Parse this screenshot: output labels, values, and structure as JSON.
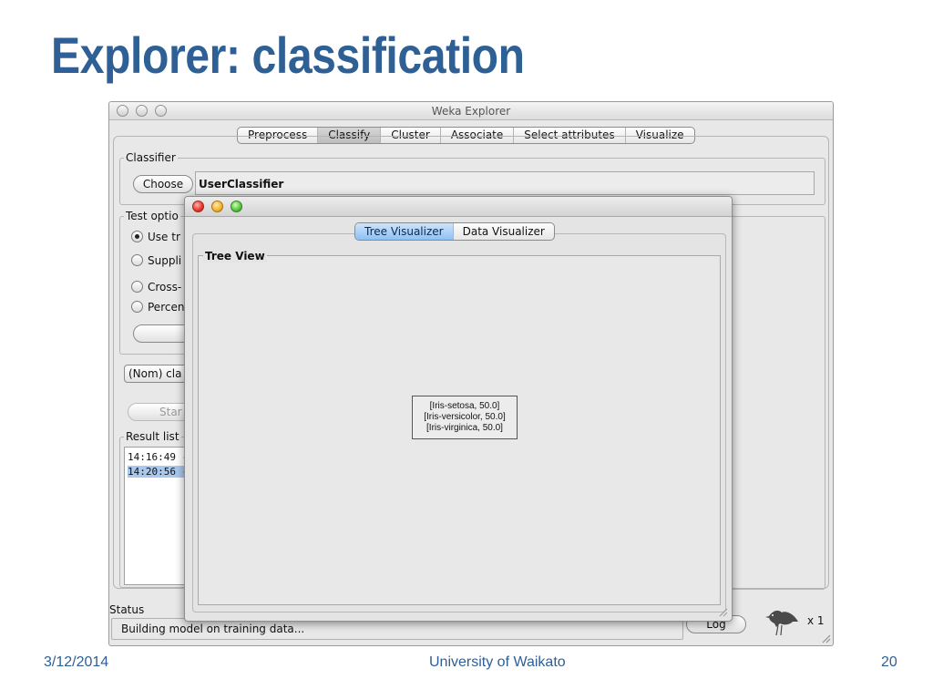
{
  "slide": {
    "title": "Explorer: classification",
    "footer_date": "3/12/2014",
    "footer_center": "University of Waikato",
    "page_number": "20"
  },
  "main_window": {
    "title": "Weka Explorer",
    "tabs": [
      "Preprocess",
      "Classify",
      "Cluster",
      "Associate",
      "Select attributes",
      "Visualize"
    ],
    "active_tab": "Classify",
    "classifier": {
      "group_label": "Classifier",
      "choose_label": "Choose",
      "name": "UserClassifier"
    },
    "test_options": {
      "group_label": "Test optio",
      "options": [
        {
          "label": "Use tr",
          "selected": true
        },
        {
          "label": "Suppli",
          "selected": false
        },
        {
          "label": "Cross-",
          "selected": false
        },
        {
          "label": "Percen",
          "selected": false
        }
      ]
    },
    "class_select": "(Nom) cla",
    "start_label": "Star",
    "result_list": {
      "group_label": "Result list",
      "items": [
        "14:16:49 -",
        "14:20:56 -"
      ],
      "selected_index": 1
    },
    "status": {
      "label": "Status",
      "text": "Building model on training data..."
    },
    "log_label": "Log",
    "task_count": "x 1"
  },
  "tree_window": {
    "tabs": [
      "Tree Visualizer",
      "Data Visualizer"
    ],
    "active_tab": "Tree Visualizer",
    "view_label": "Tree View",
    "node_lines": [
      "[Iris-setosa, 50.0]",
      "[Iris-versicolor, 50.0]",
      "[Iris-virginica, 50.0]"
    ]
  },
  "colors": {
    "title_blue": "#2e5f95",
    "selection_blue": "#a9c8ee",
    "active_tab_blue": "#8ec0f3"
  },
  "icons": {
    "traffic_lights": [
      "close-icon",
      "minimize-icon",
      "zoom-icon"
    ],
    "status_icon": "weka-bird-icon",
    "resize": "resize-grip-icon"
  }
}
